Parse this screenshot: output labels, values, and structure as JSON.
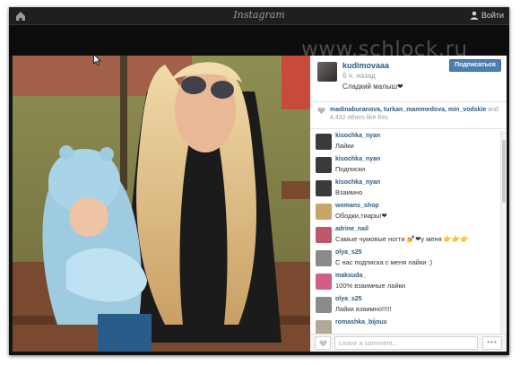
{
  "topbar": {
    "logo_text": "Instagram",
    "login_label": "Войти"
  },
  "watermark": "www.schlock.ru",
  "post": {
    "owner": "kudimovaaa",
    "time_ago": "6 ч. назад",
    "caption": "Сладкий малыш❤",
    "follow_label": "Подписаться",
    "likes_users": "madinaburanova, turkan_mammedova, min_vodskie",
    "likes_rest": "and 4,432 others like this."
  },
  "comments": [
    {
      "user": "kisochka_nyan",
      "text": "Лайки",
      "avatar_color": "#3a3a3a"
    },
    {
      "user": "kisochka_nyan",
      "text": "Подписки",
      "avatar_color": "#3a3a3a"
    },
    {
      "user": "kisochka_nyan",
      "text": "Взаимно",
      "avatar_color": "#3a3a3a"
    },
    {
      "user": "womans_shop",
      "text": "Ободки,тиары!❤",
      "avatar_color": "#c7a46a"
    },
    {
      "user": "adrine_nail",
      "text": "Самые чумовые ногти 💅❤у меня 👉👉👉",
      "avatar_color": "#b85a6a"
    },
    {
      "user": "olya_s25",
      "text": "С нас подписка с меня лайки :)",
      "avatar_color": "#8a8a8a"
    },
    {
      "user": "maksuda_",
      "text": "100% взаимные лайки",
      "avatar_color": "#d35d84"
    },
    {
      "user": "olya_s25",
      "text": "Лайки взаимно!!!!!",
      "avatar_color": "#8a8a8a"
    },
    {
      "user": "romashka_bijoux",
      "text": "",
      "avatar_color": "#b3a79a"
    }
  ],
  "footer": {
    "comment_placeholder": "Leave a comment...",
    "more_label": "•••"
  }
}
